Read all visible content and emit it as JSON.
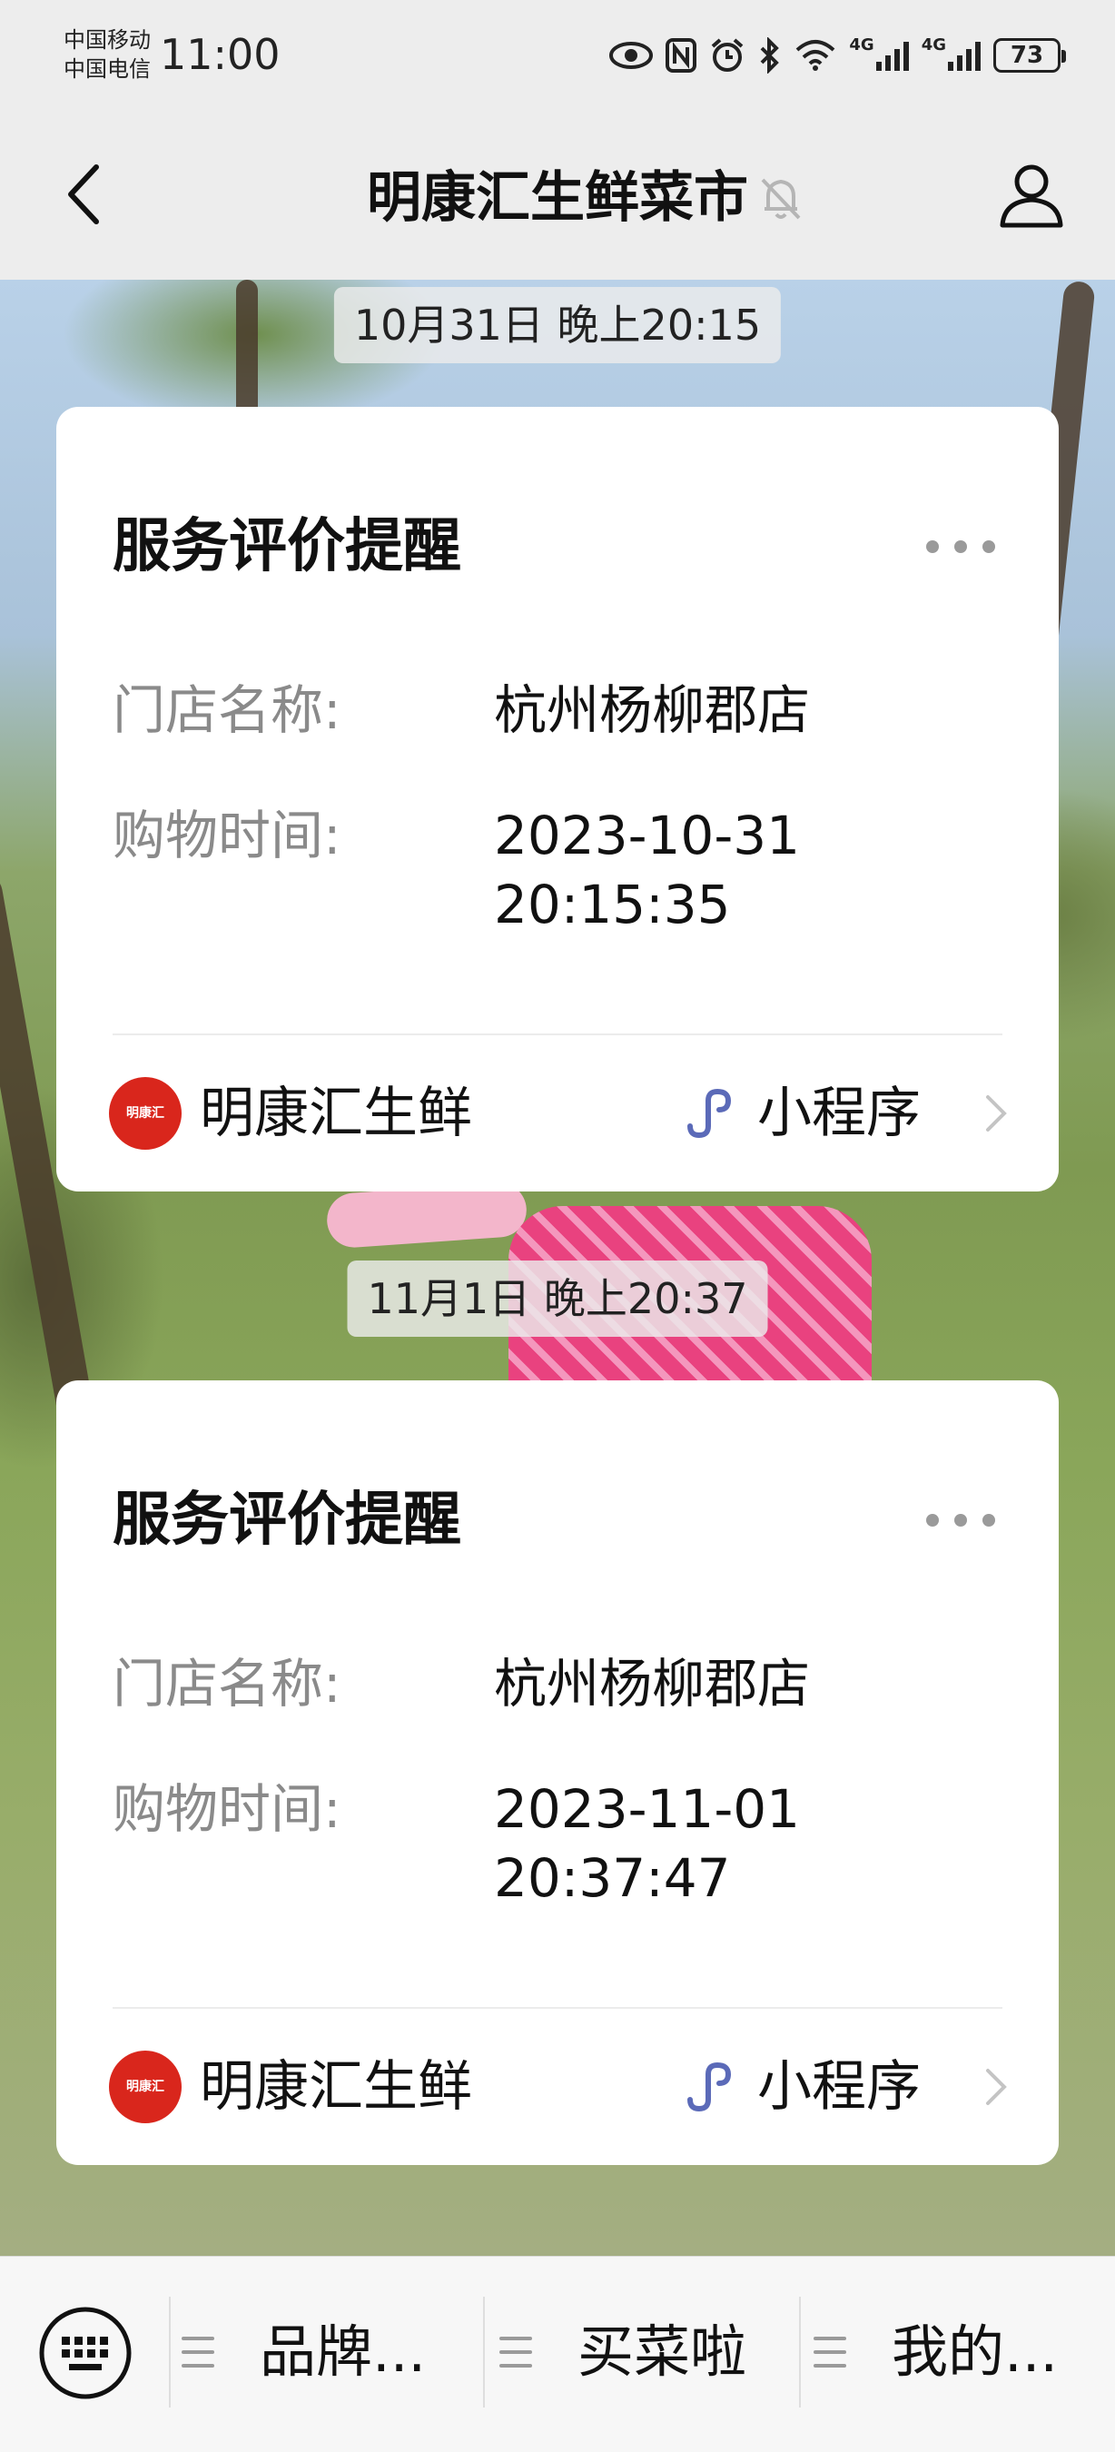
{
  "status_bar": {
    "carrier_1": "中国移动",
    "carrier_2": "中国电信",
    "time": "11:00",
    "network_1": "4G",
    "network_2": "4G",
    "battery": "73",
    "icons": [
      "eye-icon",
      "nfc-icon",
      "alarm-icon",
      "bluetooth-icon",
      "wifi-icon",
      "signal-icon",
      "signal-icon",
      "battery-icon"
    ]
  },
  "header": {
    "title": "明康汇生鲜菜市",
    "icons": [
      "back-arrow-icon",
      "mute-bell-icon",
      "profile-icon"
    ]
  },
  "messages": [
    {
      "timestamp": "10月31日 晚上20:15",
      "card": {
        "title": "服务评价提醒",
        "fields": [
          {
            "label": "门店名称:",
            "value": "杭州杨柳郡店"
          },
          {
            "label": "购物时间:",
            "value_line1": "2023-10-31",
            "value_line2": "20:15:35"
          }
        ],
        "brand_name": "明康汇生鲜",
        "brand_logo_text": "明康汇",
        "mini_program_label": "小程序"
      }
    },
    {
      "timestamp": "11月1日 晚上20:37",
      "card": {
        "title": "服务评价提醒",
        "fields": [
          {
            "label": "门店名称:",
            "value": "杭州杨柳郡店"
          },
          {
            "label": "购物时间:",
            "value_line1": "2023-11-01",
            "value_line2": "20:37:47"
          }
        ],
        "brand_name": "明康汇生鲜",
        "brand_logo_text": "明康汇",
        "mini_program_label": "小程序"
      }
    }
  ],
  "bottom_menu": {
    "items": [
      {
        "label": "品牌..."
      },
      {
        "label": "买菜啦"
      },
      {
        "label": "我的..."
      }
    ]
  },
  "colors": {
    "brand_red": "#d9261c",
    "mini_program_blue": "#5b6ab8",
    "background": "#ededed"
  }
}
